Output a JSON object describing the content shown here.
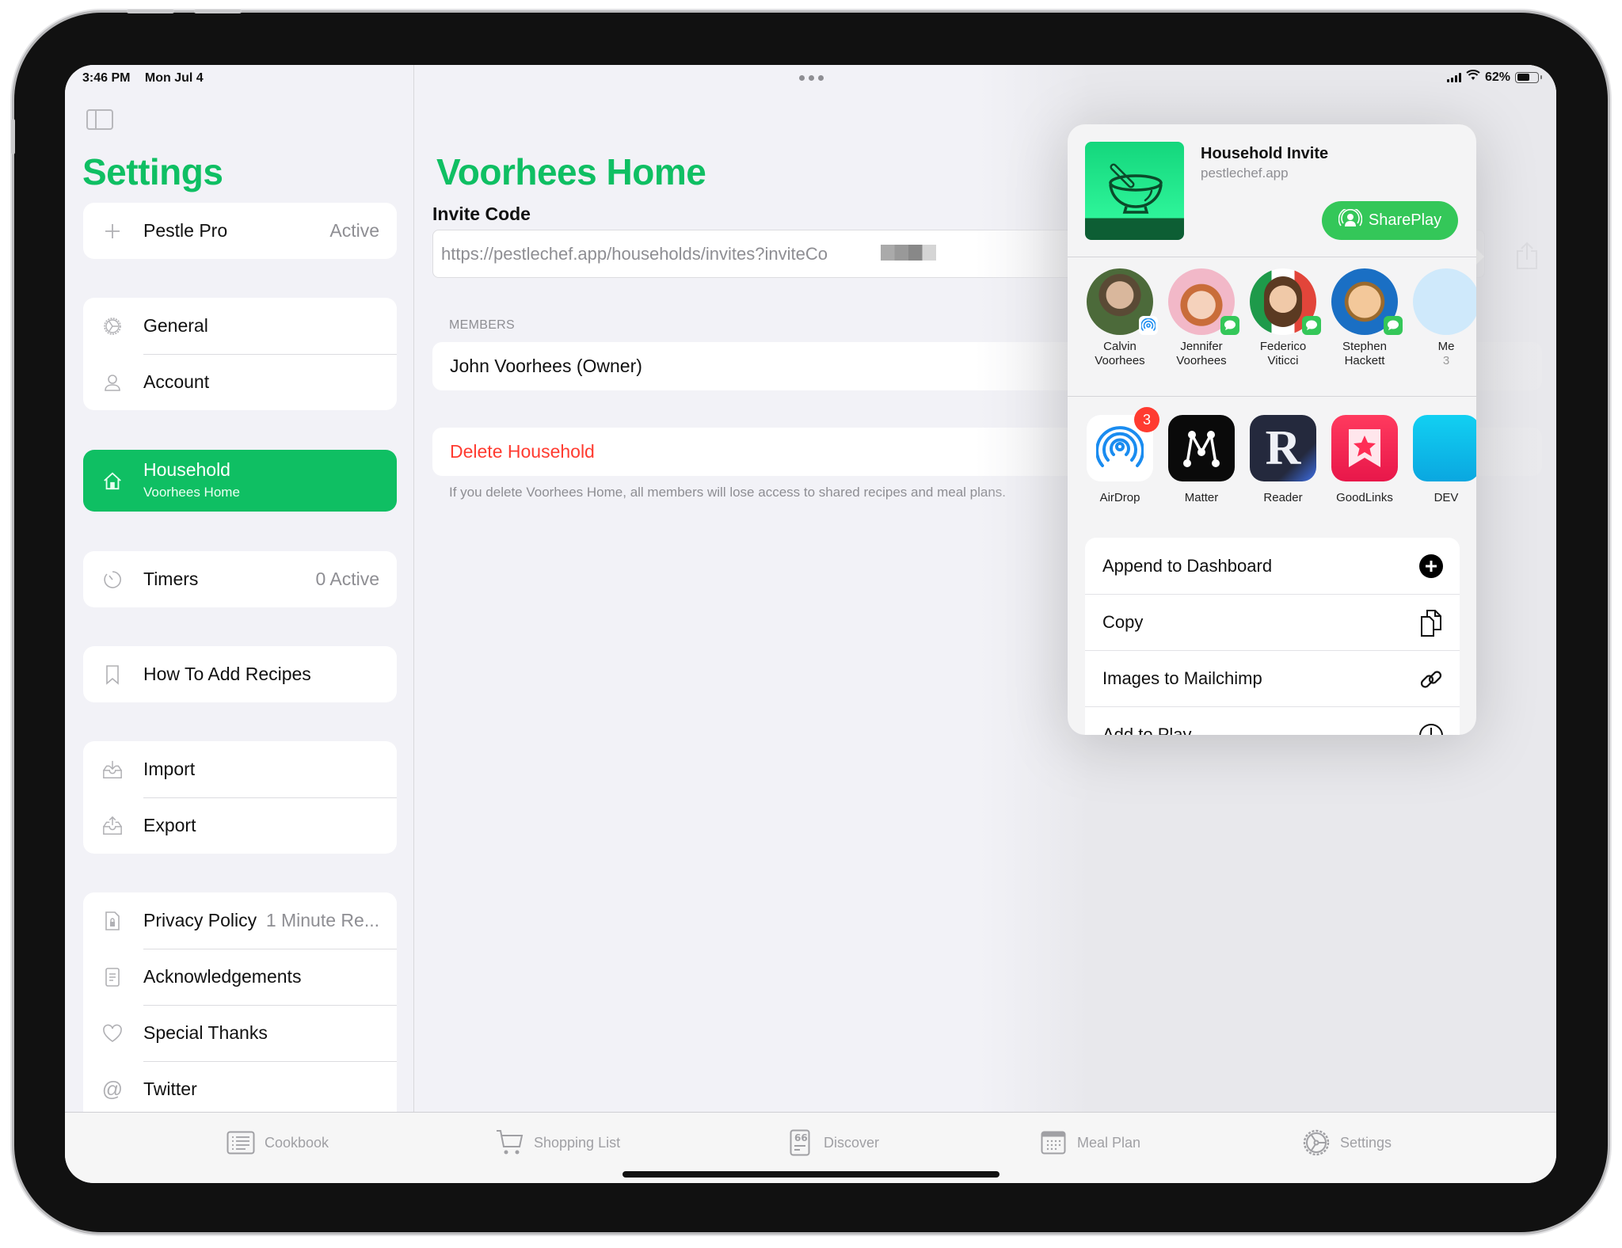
{
  "status_bar": {
    "time": "3:46 PM",
    "date": "Mon Jul 4",
    "battery": "62%",
    "battery_level": 0.62
  },
  "sidebar": {
    "title": "Settings",
    "groups": [
      {
        "items": [
          {
            "icon": "plus-icon",
            "label": "Pestle Pro",
            "value": "Active"
          }
        ]
      },
      {
        "items": [
          {
            "icon": "gear-icon",
            "label": "General"
          },
          {
            "icon": "person-icon",
            "label": "Account"
          }
        ]
      },
      {
        "items": [
          {
            "icon": "house-icon",
            "label": "Household",
            "subtitle": "Voorhees Home",
            "selected": true
          }
        ]
      },
      {
        "items": [
          {
            "icon": "timer-icon",
            "label": "Timers",
            "value": "0 Active"
          }
        ]
      },
      {
        "items": [
          {
            "icon": "bookmark-icon",
            "label": "How To Add Recipes"
          }
        ]
      },
      {
        "items": [
          {
            "icon": "tray-download-icon",
            "label": "Import"
          },
          {
            "icon": "tray-upload-icon",
            "label": "Export"
          }
        ]
      },
      {
        "items": [
          {
            "icon": "lock-doc-icon",
            "label": "Privacy Policy",
            "value": "1 Minute Re..."
          },
          {
            "icon": "document-icon",
            "label": "Acknowledgements"
          },
          {
            "icon": "heart-icon",
            "label": "Special Thanks"
          },
          {
            "icon": "at-icon",
            "label": "Twitter"
          }
        ]
      }
    ]
  },
  "detail": {
    "title": "Voorhees Home",
    "invite_label": "Invite Code",
    "invite_value": "https://pestlechef.app/households/invites?inviteCo",
    "members_header": "MEMBERS",
    "members": [
      "John Voorhees (Owner)"
    ],
    "delete_label": "Delete Household",
    "delete_footnote": "If you delete Voorhees Home, all members will lose access to shared recipes and meal plans."
  },
  "share_sheet": {
    "title": "Household Invite",
    "subtitle": "pestlechef.app",
    "shareplay_label": "SharePlay",
    "people": [
      {
        "name_line1": "Calvin",
        "name_line2": "Voorhees",
        "via": "airdrop"
      },
      {
        "name_line1": "Jennifer",
        "name_line2": "Voorhees",
        "via": "messages"
      },
      {
        "name_line1": "Federico",
        "name_line2": "Viticci",
        "via": "messages"
      },
      {
        "name_line1": "Stephen",
        "name_line2": "Hackett",
        "via": "messages"
      },
      {
        "name_line1": "Me",
        "name_line2": "3",
        "via": ""
      }
    ],
    "apps": [
      {
        "name": "AirDrop",
        "badge": "3"
      },
      {
        "name": "Matter"
      },
      {
        "name": "Reader"
      },
      {
        "name": "GoodLinks"
      },
      {
        "name": "DEV"
      }
    ],
    "actions": [
      {
        "label": "Append to Dashboard",
        "icon": "plus-circle-icon"
      },
      {
        "label": "Copy",
        "icon": "copy-icon"
      },
      {
        "label": "Images to Mailchimp",
        "icon": "link-icon"
      },
      {
        "label": "Add to Play",
        "icon": "clock-icon"
      }
    ]
  },
  "tab_bar": {
    "tabs": [
      {
        "label": "Cookbook",
        "icon": "list-icon"
      },
      {
        "label": "Shopping List",
        "icon": "cart-icon"
      },
      {
        "label": "Discover",
        "icon": "quote-icon"
      },
      {
        "label": "Meal Plan",
        "icon": "calendar-icon"
      },
      {
        "label": "Settings",
        "icon": "gear-icon"
      }
    ]
  },
  "colors": {
    "accent": "#0fbf63",
    "destructive": "#ff3b30",
    "shareplay": "#34c759"
  }
}
